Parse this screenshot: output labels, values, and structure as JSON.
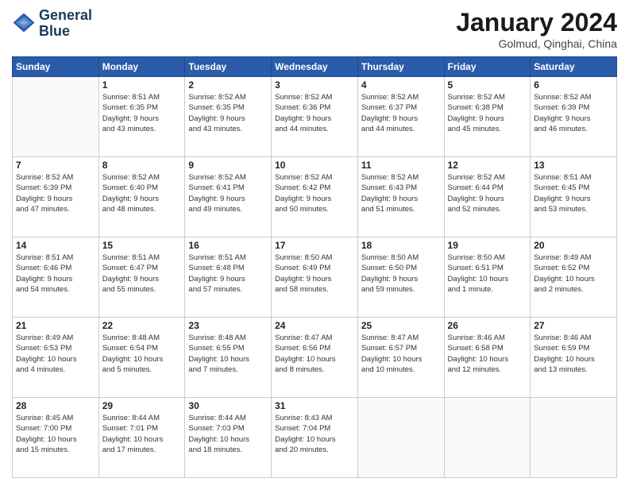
{
  "header": {
    "logo_line1": "General",
    "logo_line2": "Blue",
    "month": "January 2024",
    "location": "Golmud, Qinghai, China"
  },
  "days": [
    "Sunday",
    "Monday",
    "Tuesday",
    "Wednesday",
    "Thursday",
    "Friday",
    "Saturday"
  ],
  "weeks": [
    [
      {
        "day": "",
        "info": ""
      },
      {
        "day": "1",
        "info": "Sunrise: 8:51 AM\nSunset: 6:35 PM\nDaylight: 9 hours\nand 43 minutes."
      },
      {
        "day": "2",
        "info": "Sunrise: 8:52 AM\nSunset: 6:35 PM\nDaylight: 9 hours\nand 43 minutes."
      },
      {
        "day": "3",
        "info": "Sunrise: 8:52 AM\nSunset: 6:36 PM\nDaylight: 9 hours\nand 44 minutes."
      },
      {
        "day": "4",
        "info": "Sunrise: 8:52 AM\nSunset: 6:37 PM\nDaylight: 9 hours\nand 44 minutes."
      },
      {
        "day": "5",
        "info": "Sunrise: 8:52 AM\nSunset: 6:38 PM\nDaylight: 9 hours\nand 45 minutes."
      },
      {
        "day": "6",
        "info": "Sunrise: 8:52 AM\nSunset: 6:39 PM\nDaylight: 9 hours\nand 46 minutes."
      }
    ],
    [
      {
        "day": "7",
        "info": "Sunrise: 8:52 AM\nSunset: 6:39 PM\nDaylight: 9 hours\nand 47 minutes."
      },
      {
        "day": "8",
        "info": "Sunrise: 8:52 AM\nSunset: 6:40 PM\nDaylight: 9 hours\nand 48 minutes."
      },
      {
        "day": "9",
        "info": "Sunrise: 8:52 AM\nSunset: 6:41 PM\nDaylight: 9 hours\nand 49 minutes."
      },
      {
        "day": "10",
        "info": "Sunrise: 8:52 AM\nSunset: 6:42 PM\nDaylight: 9 hours\nand 50 minutes."
      },
      {
        "day": "11",
        "info": "Sunrise: 8:52 AM\nSunset: 6:43 PM\nDaylight: 9 hours\nand 51 minutes."
      },
      {
        "day": "12",
        "info": "Sunrise: 8:52 AM\nSunset: 6:44 PM\nDaylight: 9 hours\nand 52 minutes."
      },
      {
        "day": "13",
        "info": "Sunrise: 8:51 AM\nSunset: 6:45 PM\nDaylight: 9 hours\nand 53 minutes."
      }
    ],
    [
      {
        "day": "14",
        "info": "Sunrise: 8:51 AM\nSunset: 6:46 PM\nDaylight: 9 hours\nand 54 minutes."
      },
      {
        "day": "15",
        "info": "Sunrise: 8:51 AM\nSunset: 6:47 PM\nDaylight: 9 hours\nand 55 minutes."
      },
      {
        "day": "16",
        "info": "Sunrise: 8:51 AM\nSunset: 6:48 PM\nDaylight: 9 hours\nand 57 minutes."
      },
      {
        "day": "17",
        "info": "Sunrise: 8:50 AM\nSunset: 6:49 PM\nDaylight: 9 hours\nand 58 minutes."
      },
      {
        "day": "18",
        "info": "Sunrise: 8:50 AM\nSunset: 6:50 PM\nDaylight: 9 hours\nand 59 minutes."
      },
      {
        "day": "19",
        "info": "Sunrise: 8:50 AM\nSunset: 6:51 PM\nDaylight: 10 hours\nand 1 minute."
      },
      {
        "day": "20",
        "info": "Sunrise: 8:49 AM\nSunset: 6:52 PM\nDaylight: 10 hours\nand 2 minutes."
      }
    ],
    [
      {
        "day": "21",
        "info": "Sunrise: 8:49 AM\nSunset: 6:53 PM\nDaylight: 10 hours\nand 4 minutes."
      },
      {
        "day": "22",
        "info": "Sunrise: 8:48 AM\nSunset: 6:54 PM\nDaylight: 10 hours\nand 5 minutes."
      },
      {
        "day": "23",
        "info": "Sunrise: 8:48 AM\nSunset: 6:55 PM\nDaylight: 10 hours\nand 7 minutes."
      },
      {
        "day": "24",
        "info": "Sunrise: 8:47 AM\nSunset: 6:56 PM\nDaylight: 10 hours\nand 8 minutes."
      },
      {
        "day": "25",
        "info": "Sunrise: 8:47 AM\nSunset: 6:57 PM\nDaylight: 10 hours\nand 10 minutes."
      },
      {
        "day": "26",
        "info": "Sunrise: 8:46 AM\nSunset: 6:58 PM\nDaylight: 10 hours\nand 12 minutes."
      },
      {
        "day": "27",
        "info": "Sunrise: 8:46 AM\nSunset: 6:59 PM\nDaylight: 10 hours\nand 13 minutes."
      }
    ],
    [
      {
        "day": "28",
        "info": "Sunrise: 8:45 AM\nSunset: 7:00 PM\nDaylight: 10 hours\nand 15 minutes."
      },
      {
        "day": "29",
        "info": "Sunrise: 8:44 AM\nSunset: 7:01 PM\nDaylight: 10 hours\nand 17 minutes."
      },
      {
        "day": "30",
        "info": "Sunrise: 8:44 AM\nSunset: 7:03 PM\nDaylight: 10 hours\nand 18 minutes."
      },
      {
        "day": "31",
        "info": "Sunrise: 8:43 AM\nSunset: 7:04 PM\nDaylight: 10 hours\nand 20 minutes."
      },
      {
        "day": "",
        "info": ""
      },
      {
        "day": "",
        "info": ""
      },
      {
        "day": "",
        "info": ""
      }
    ]
  ]
}
